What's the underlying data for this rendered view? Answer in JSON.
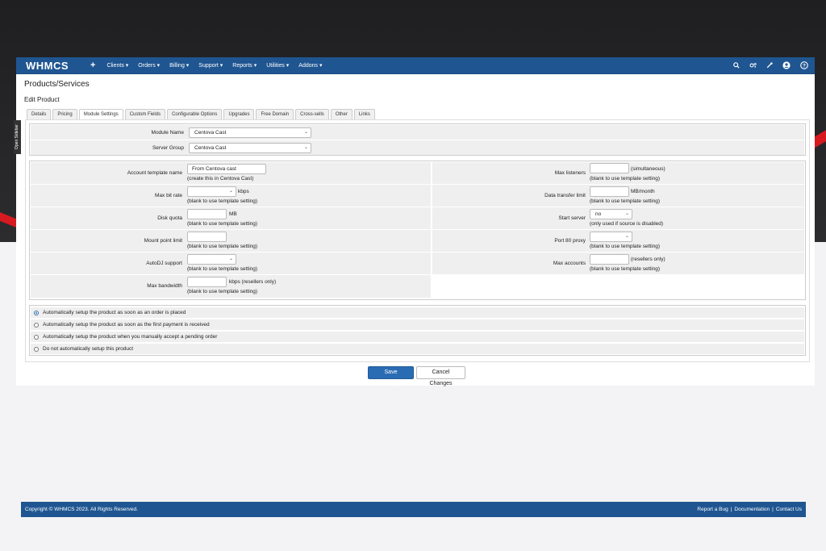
{
  "nav": {
    "logo": "WHMCS",
    "plus": "+",
    "items": [
      "Clients ▾",
      "Orders ▾",
      "Billing ▾",
      "Support ▾",
      "Reports ▾",
      "Utilities ▾",
      "Addons ▾"
    ],
    "icons": [
      "search-icon",
      "gear-icon",
      "wrench-icon",
      "user-icon",
      "help-icon"
    ]
  },
  "sidebar_tab": "Open Sidebar",
  "page": {
    "title": "Products/Services",
    "subtitle": "Edit Product"
  },
  "tabs": [
    {
      "label": "Details",
      "active": false
    },
    {
      "label": "Pricing",
      "active": false
    },
    {
      "label": "Module Settings",
      "active": true
    },
    {
      "label": "Custom Fields",
      "active": false
    },
    {
      "label": "Configurable Options",
      "active": false
    },
    {
      "label": "Upgrades",
      "active": false
    },
    {
      "label": "Free Domain",
      "active": false
    },
    {
      "label": "Cross-sells",
      "active": false
    },
    {
      "label": "Other",
      "active": false
    },
    {
      "label": "Links",
      "active": false
    }
  ],
  "module": {
    "module_name_label": "Module Name",
    "module_name_value": "Centova Cast",
    "server_group_label": "Server Group",
    "server_group_value": "Centova Cast"
  },
  "settings": {
    "account_template": {
      "label": "Account template name",
      "value": "From Centova cast",
      "help": "(create this in Centova Cast)"
    },
    "max_bit_rate": {
      "label": "Max bit rate",
      "suffix": "kbps",
      "help": "(blank to use template setting)"
    },
    "disk_quota": {
      "label": "Disk quota",
      "suffix": "MB",
      "help": "(blank to use template setting)"
    },
    "mount_point_limit": {
      "label": "Mount point limit",
      "help": "(blank to use template setting)"
    },
    "autodj_support": {
      "label": "AutoDJ support",
      "help": "(blank to use template setting)"
    },
    "max_bandwidth": {
      "label": "Max bandwidth",
      "suffix": "kbps (resellers only)",
      "help": "(blank to use template setting)"
    },
    "max_listeners": {
      "label": "Max listeners",
      "suffix": "(simultaneous)",
      "help": "(blank to use template setting)"
    },
    "data_transfer_limit": {
      "label": "Data transfer limit",
      "suffix": "MB/month",
      "help": "(blank to use template setting)"
    },
    "start_server": {
      "label": "Start server",
      "value": "no",
      "help": "(only used if source is disabled)"
    },
    "port80_proxy": {
      "label": "Port 80 proxy",
      "help": "(blank to use template setting)"
    },
    "max_accounts": {
      "label": "Max accounts",
      "suffix": "(resellers only)",
      "help": "(blank to use template setting)"
    }
  },
  "setup_options": [
    {
      "label": "Automatically setup the product as soon as an order is placed",
      "selected": true
    },
    {
      "label": "Automatically setup the product as soon as the first payment is received",
      "selected": false
    },
    {
      "label": "Automatically setup the product when you manually accept a pending order",
      "selected": false
    },
    {
      "label": "Do not automatically setup this product",
      "selected": false
    }
  ],
  "buttons": {
    "save": "Save Changes",
    "cancel": "Cancel Changes"
  },
  "footer": {
    "copyright": "Copyright © WHMCS 2023. All Rights Reserved.",
    "links": [
      "Report a Bug",
      "|",
      "Documentation",
      "|",
      "Contact Us"
    ]
  }
}
